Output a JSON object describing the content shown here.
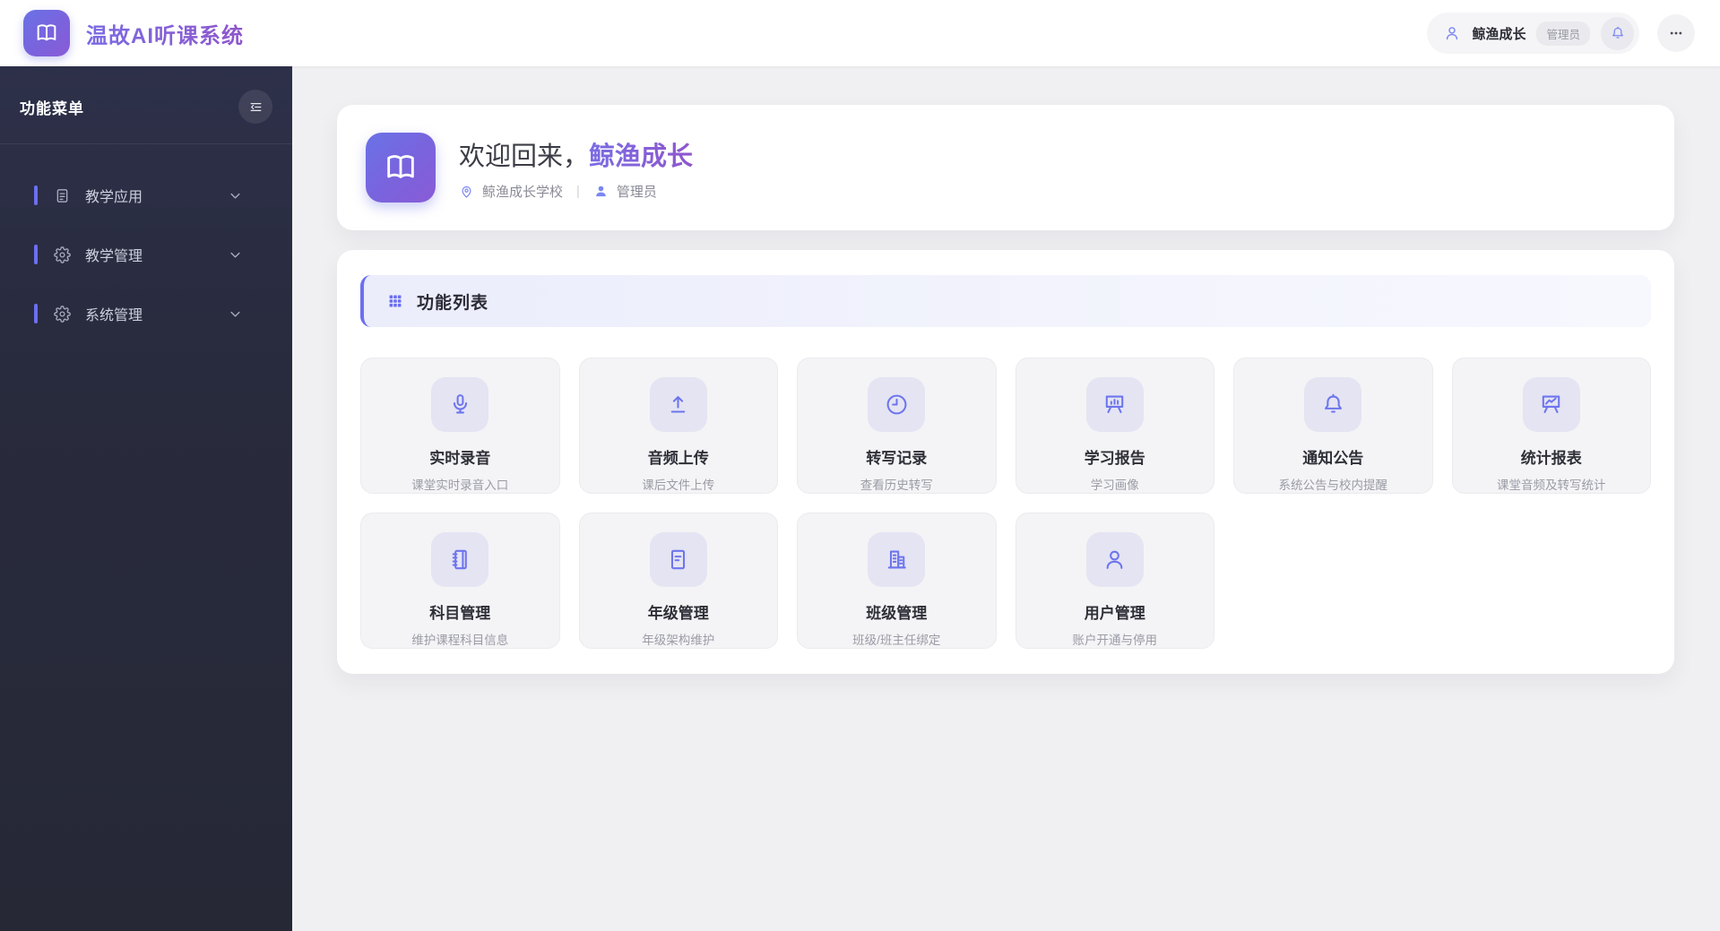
{
  "header": {
    "app_title": "温故AI听课系统",
    "user": {
      "name": "鲸渔成长",
      "role_badge": "管理员"
    }
  },
  "sidebar": {
    "title": "功能菜单",
    "items": [
      {
        "label": "教学应用",
        "icon": "document-icon"
      },
      {
        "label": "教学管理",
        "icon": "gear-icon"
      },
      {
        "label": "系统管理",
        "icon": "gear-icon"
      }
    ]
  },
  "main": {
    "welcome": {
      "greeting_prefix": "欢迎回来，",
      "user_name": "鲸渔成长",
      "school": "鲸渔成长学校",
      "divider": "|",
      "role": "管理员"
    },
    "function_list": {
      "title": "功能列表",
      "cards": [
        {
          "title": "实时录音",
          "subtitle": "课堂实时录音入口",
          "icon": "microphone-icon"
        },
        {
          "title": "音频上传",
          "subtitle": "课后文件上传",
          "icon": "upload-icon"
        },
        {
          "title": "转写记录",
          "subtitle": "查看历史转写",
          "icon": "clock-icon"
        },
        {
          "title": "学习报告",
          "subtitle": "学习画像",
          "icon": "presentation-bars-icon"
        },
        {
          "title": "通知公告",
          "subtitle": "系统公告与校内提醒",
          "icon": "bell-icon"
        },
        {
          "title": "统计报表",
          "subtitle": "课堂音频及转写统计",
          "icon": "presentation-chart-icon"
        },
        {
          "title": "科目管理",
          "subtitle": "维护课程科目信息",
          "icon": "notebook-icon"
        },
        {
          "title": "年级管理",
          "subtitle": "年级架构维护",
          "icon": "document-lines-icon"
        },
        {
          "title": "班级管理",
          "subtitle": "班级/班主任绑定",
          "icon": "building-icon"
        },
        {
          "title": "用户管理",
          "subtitle": "账户开通与停用",
          "icon": "user-icon"
        }
      ]
    }
  },
  "colors": {
    "accent": "#6c6ff0",
    "icon_purple": "#6d75ee",
    "sidebar_bg": "#262836",
    "page_bg": "#f0f0f2"
  }
}
